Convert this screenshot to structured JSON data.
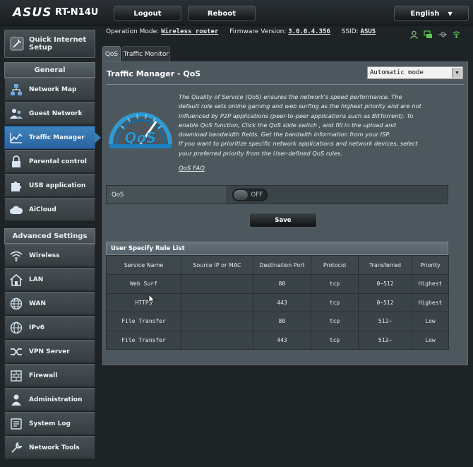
{
  "header": {
    "logo": "ASUS",
    "model": "RT-N14U",
    "logout_label": "Logout",
    "reboot_label": "Reboot",
    "language": "English"
  },
  "status": {
    "op_mode_label": "Operation Mode:",
    "op_mode_value": "Wireless router",
    "firmware_label": "Firmware Version:",
    "firmware_value": "3.0.0.4.356",
    "ssid_label": "SSID:",
    "ssid_value": "ASUS",
    "icons": [
      "user-icon",
      "wan-connected-icon",
      "usb-icon",
      "wifi-icon"
    ]
  },
  "sidebar": {
    "quick_setup_line1": "Quick Internet",
    "quick_setup_line2": "Setup",
    "general_header": "General",
    "general_items": [
      {
        "label": "Network Map",
        "icon": "network-map-icon"
      },
      {
        "label": "Guest Network",
        "icon": "guest-network-icon"
      },
      {
        "label": "Traffic Manager",
        "icon": "traffic-manager-icon",
        "active": true
      },
      {
        "label": "Parental control",
        "icon": "parental-lock-icon"
      },
      {
        "label": "USB application",
        "icon": "puzzle-icon"
      },
      {
        "label": "AiCloud",
        "icon": "cloud-icon"
      }
    ],
    "advanced_header": "Advanced Settings",
    "advanced_items": [
      {
        "label": "Wireless",
        "icon": "wifi-icon"
      },
      {
        "label": "LAN",
        "icon": "home-icon"
      },
      {
        "label": "WAN",
        "icon": "globe-icon"
      },
      {
        "label": "IPv6",
        "icon": "ipv6-globe-icon"
      },
      {
        "label": "VPN Server",
        "icon": "vpn-icon"
      },
      {
        "label": "Firewall",
        "icon": "firewall-icon"
      },
      {
        "label": "Administration",
        "icon": "admin-user-icon"
      },
      {
        "label": "System Log",
        "icon": "log-icon"
      },
      {
        "label": "Network Tools",
        "icon": "tools-icon"
      }
    ]
  },
  "tabs": [
    {
      "label": "QoS",
      "active": true
    },
    {
      "label": "Traffic Monitor",
      "active": false
    }
  ],
  "main": {
    "title": "Traffic Manager - QoS",
    "mode_select": "Automatic mode",
    "description": "The Quality of Service (QoS) ensures the network's speed performance. The default rule sets online gaming and web surfing as the highest priority and are not influenced by P2P applications (peer-to-peer applications such as BitTorrent). To enable QoS function, Click the QoS slide switch , and fill in the upload and download bandwidth fields. Get the bandwith information from your ISP.",
    "description2": "If you want to prioritize specific network applications and network devices, select your preferred priority from the User-defined QoS rules.",
    "faq_link": "QoS FAQ",
    "qos_label": "QoS",
    "qos_toggle": "OFF",
    "save_label": "Save"
  },
  "rules": {
    "title": "User Specify Rule List",
    "columns": [
      "Service Name",
      "Source IP or MAC",
      "Destination Port",
      "Protocol",
      "Transferred",
      "Priority"
    ],
    "rows": [
      [
        "Web Surf",
        "",
        "80",
        "tcp",
        "0~512",
        "Highest"
      ],
      [
        "HTTPS",
        "",
        "443",
        "tcp",
        "0~512",
        "Highest"
      ],
      [
        "File Transfer",
        "",
        "80",
        "tcp",
        "512~",
        "Low"
      ],
      [
        "File Transfer",
        "",
        "443",
        "tcp",
        "512~",
        "Low"
      ]
    ]
  },
  "colors": {
    "accent": "#3a7cb6",
    "panel": "#4d585e",
    "background": "#1e2326"
  }
}
